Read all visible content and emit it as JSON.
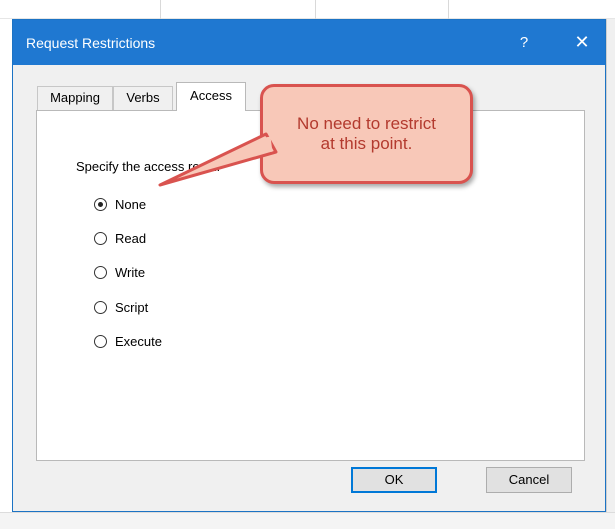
{
  "dialog": {
    "title": "Request Restrictions",
    "help_label": "?",
    "close_label": "✕"
  },
  "tabs": [
    {
      "label": "Mapping",
      "active": false
    },
    {
      "label": "Verbs",
      "active": false
    },
    {
      "label": "Access",
      "active": true
    }
  ],
  "access": {
    "prompt": "Specify the access requir",
    "options": [
      {
        "label": "None",
        "checked": true
      },
      {
        "label": "Read",
        "checked": false
      },
      {
        "label": "Write",
        "checked": false
      },
      {
        "label": "Script",
        "checked": false
      },
      {
        "label": "Execute",
        "checked": false
      }
    ]
  },
  "buttons": {
    "ok_label": "OK",
    "cancel_label": "Cancel"
  },
  "callout": {
    "line1": "No need to restrict",
    "line2": "at this point."
  },
  "colors": {
    "titlebar": "#1f78d1",
    "callout_fill": "#f8c8b8",
    "callout_border": "#d9534f"
  }
}
